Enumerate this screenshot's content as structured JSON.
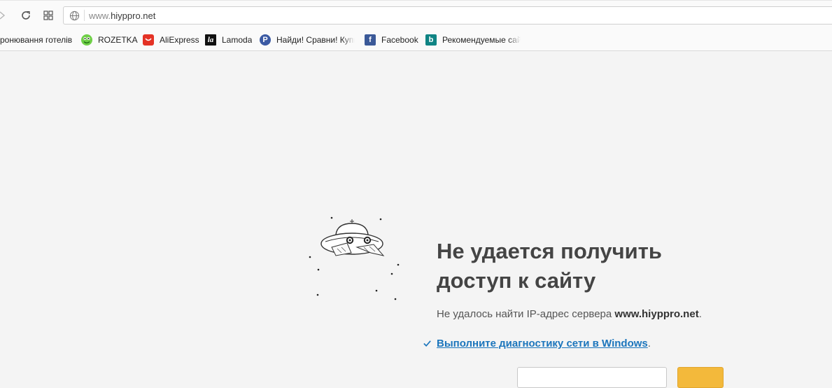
{
  "toolbar": {
    "url_prefix": "www.",
    "url_domain": "hiyppro.net"
  },
  "bookmarks": [
    {
      "label": "ронювання готелів"
    },
    {
      "label": "ROZETKA",
      "icon": "rozetka-frog-icon",
      "color": "#4caf50"
    },
    {
      "label": "AliExpress",
      "icon": "aliexpress-icon",
      "color": "#e43225"
    },
    {
      "label": "Lamoda",
      "icon": "lamoda-icon",
      "color": "#111111",
      "glyph": "la"
    },
    {
      "label": "Найди! Сравни! Купи",
      "icon": "price-compare-icon",
      "color": "#3b5aa3",
      "glyph": "P"
    },
    {
      "label": "Facebook",
      "icon": "facebook-icon",
      "color": "#3b5998",
      "glyph": "f"
    },
    {
      "label": "Рекомендуемые сайты",
      "icon": "bing-icon",
      "color": "#0f8484",
      "glyph": "b"
    }
  ],
  "error": {
    "title": "Не удается получить доступ к сайту",
    "desc_prefix": "Не удалось найти IP-адрес сервера ",
    "desc_host": "www.hiyppro.net",
    "desc_suffix": ".",
    "diagnostics_link": "Выполните диагностику сети в Windows",
    "diagnostics_suffix": "."
  },
  "colors": {
    "background": "#f4f4f4",
    "link": "#1b75bc",
    "primary_button": "#f3b93b"
  }
}
